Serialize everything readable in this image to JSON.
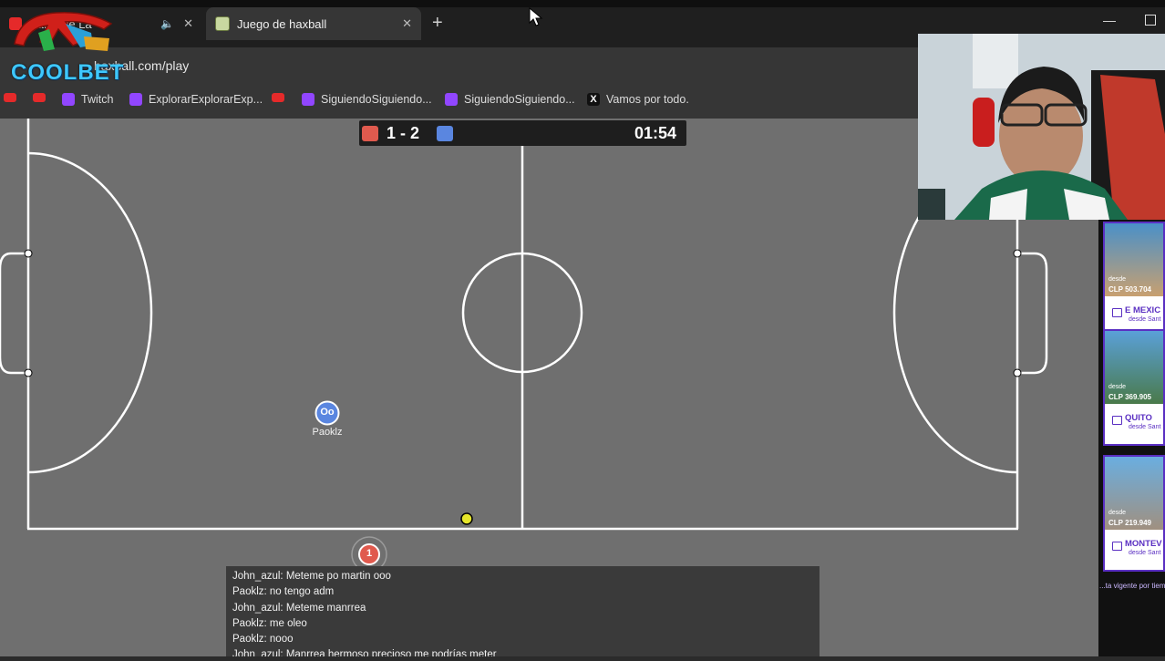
{
  "browser": {
    "tabs": [
      {
        "title": "Ba..., De La",
        "active": false,
        "audio": true
      },
      {
        "title": "Juego de haxball",
        "active": true
      }
    ],
    "url": "haxball.com/play",
    "bookmarks": [
      "Twitch",
      "ExplorarExplorarExp...",
      "SiguiendoSiguiendo...",
      "SiguiendoSiguiendo...",
      "Vamos por todo."
    ]
  },
  "overlay": {
    "logo_text": "COOLBET"
  },
  "game": {
    "score_red": 1,
    "score_blue": 2,
    "score_text": "1 - 2",
    "timer": "01:54",
    "colors": {
      "red": "#e05a4e",
      "blue": "#5a86e0",
      "field": "#6f6f6f",
      "ball": "#e6e62a"
    },
    "players": [
      {
        "name": "Paoklz",
        "initials": "Oo",
        "team": "blue"
      },
      {
        "name": "",
        "number": "1",
        "team": "red"
      }
    ]
  },
  "chat": [
    "John_azul: Meteme po martin ooo",
    "Paoklz: no tengo adm",
    "John_azul: Meteme manrrea",
    "Paoklz: me oleo",
    "Paoklz: nooo",
    "John_azul: Manrrea hermoso precioso me podrías meter"
  ],
  "ads": [
    {
      "desde": "desde",
      "price": "CLP 503.704",
      "city": "E MEXIC",
      "sub": "desde Sant"
    },
    {
      "desde": "desde",
      "price": "CLP 369.905",
      "city": "QUITO",
      "sub": "desde Sant"
    },
    {
      "desde": "desde",
      "price": "CLP 219.949",
      "city": "MONTEV",
      "sub": "desde Sant"
    }
  ],
  "ad_footer": "...ta vigente por tiempo"
}
